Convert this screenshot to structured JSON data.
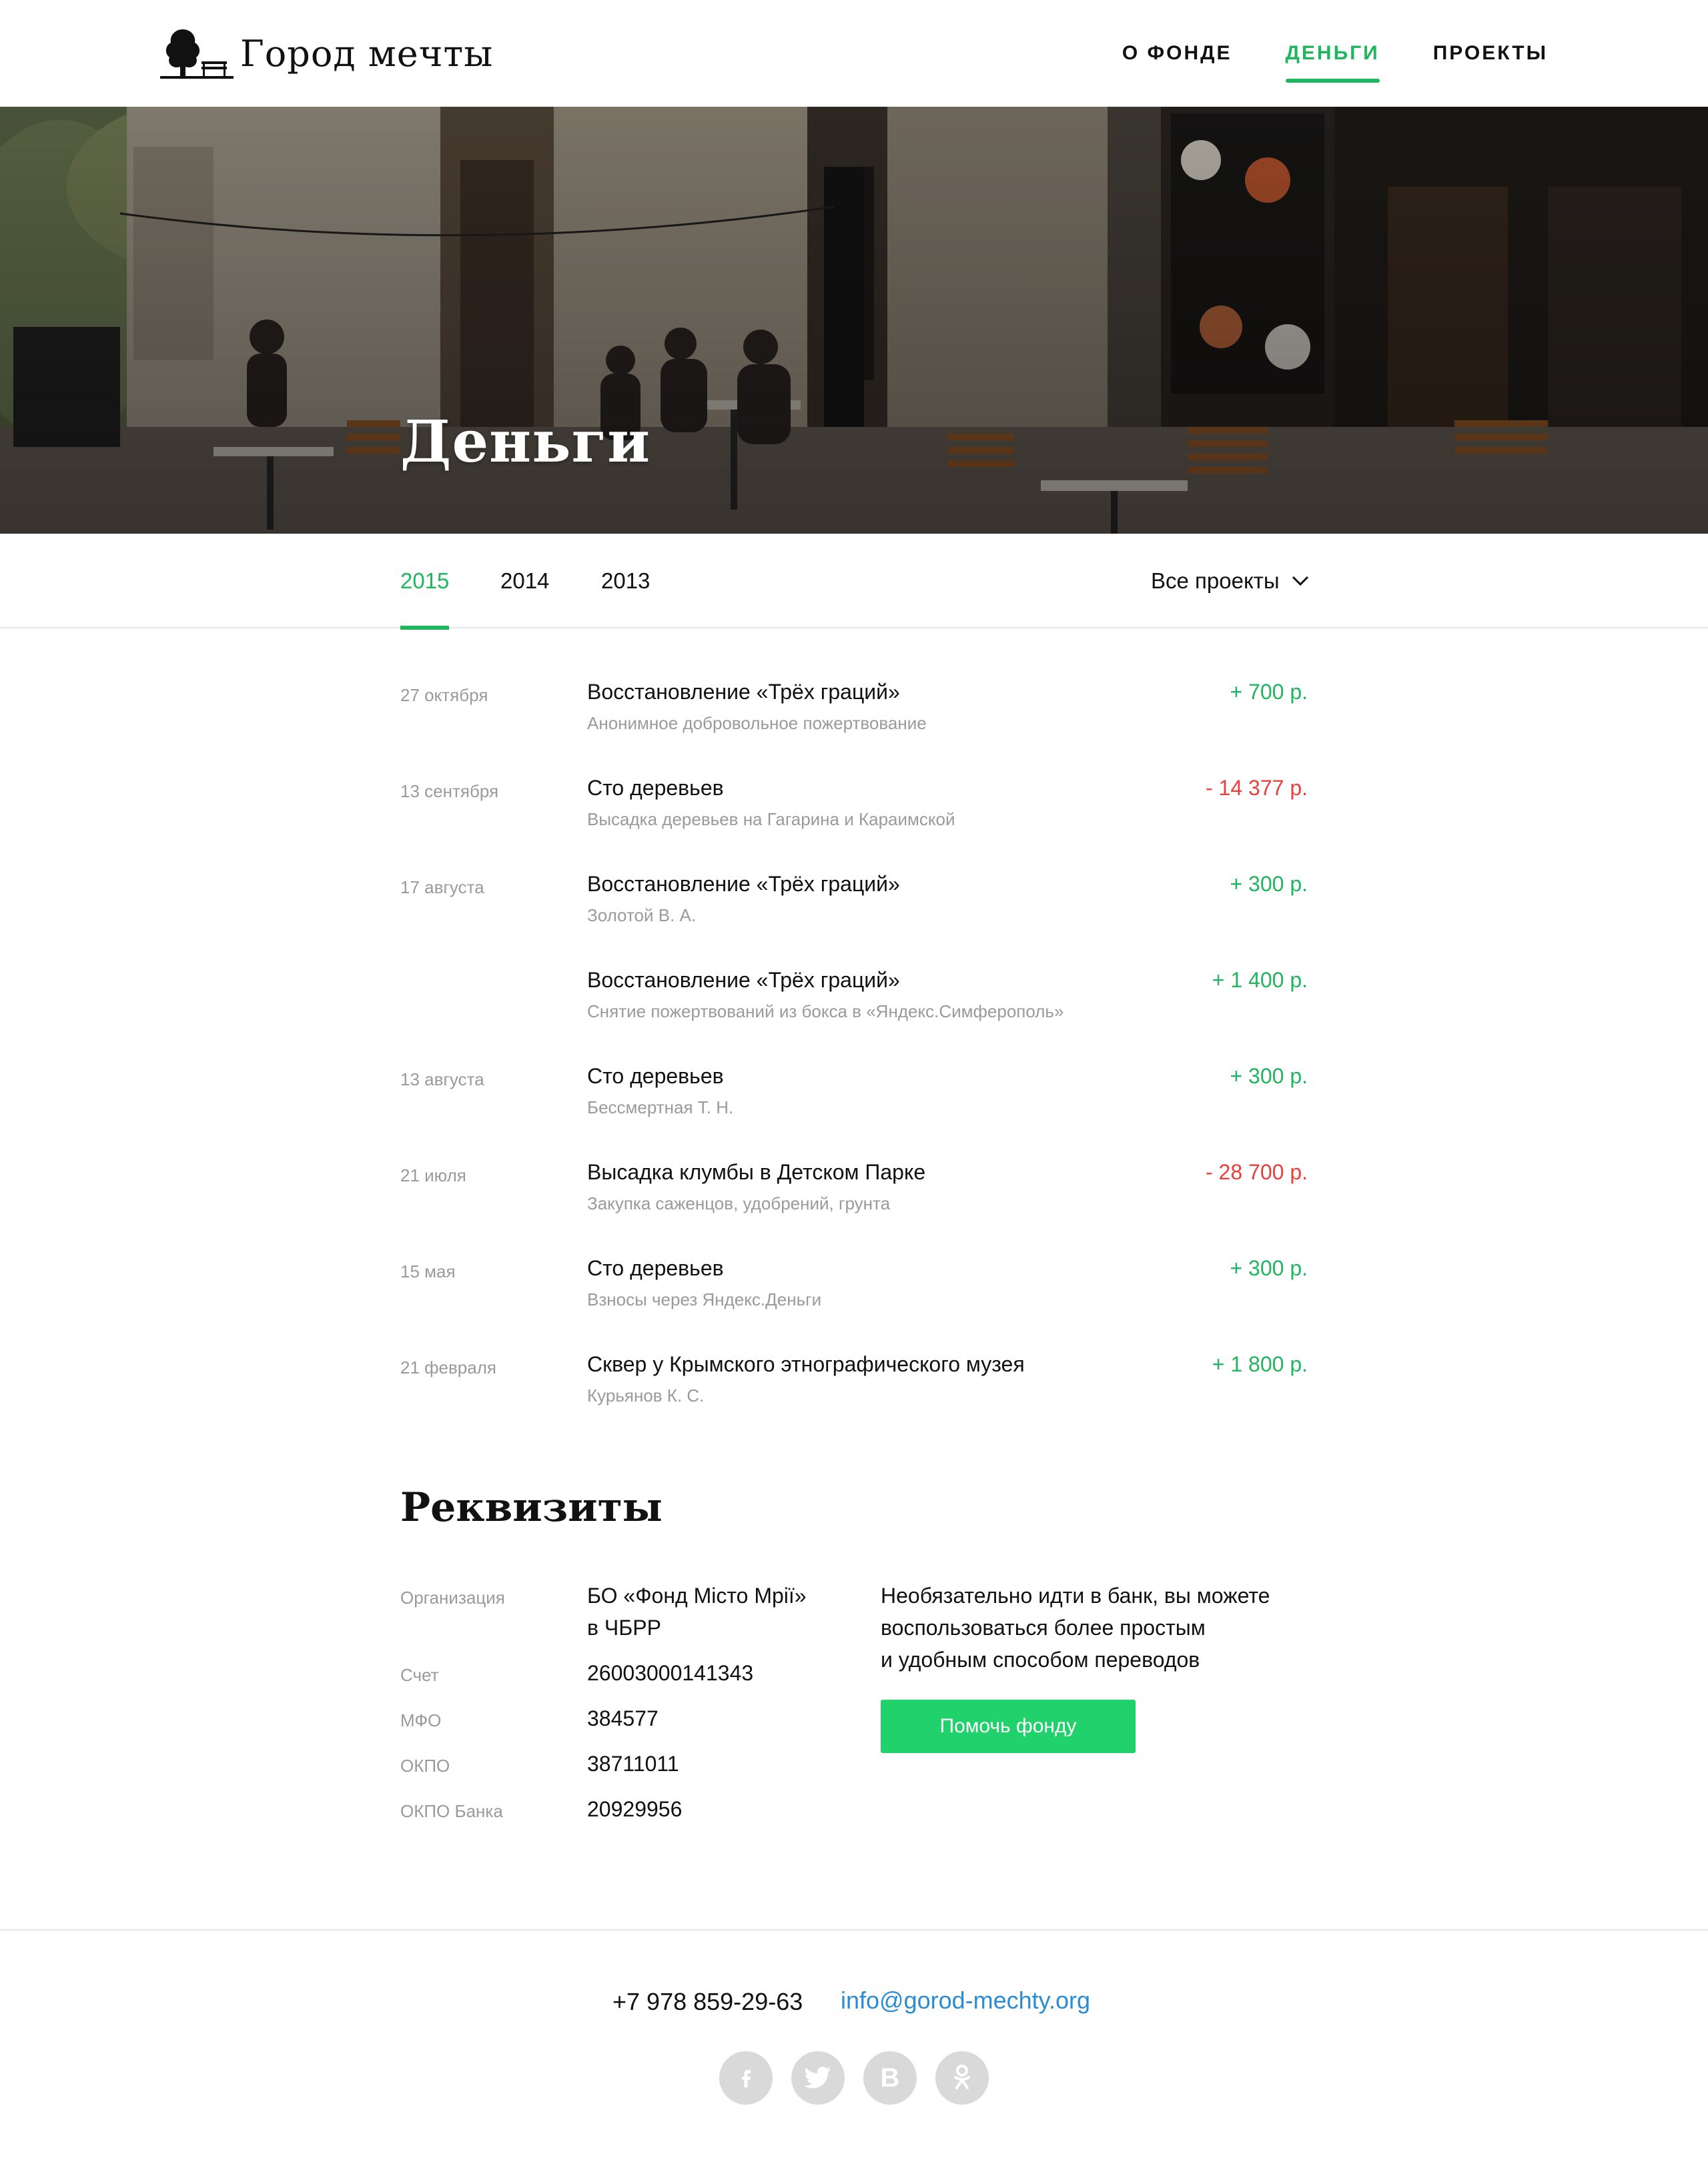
{
  "header": {
    "logo_text": "Город мечты",
    "nav": [
      {
        "label": "О ФОНДЕ"
      },
      {
        "label": "ДЕНЬГИ"
      },
      {
        "label": "ПРОЕКТЫ"
      }
    ],
    "active_nav": "ДЕНЬГИ"
  },
  "hero": {
    "title": "Деньги"
  },
  "tabs": {
    "years": [
      {
        "label": "2015"
      },
      {
        "label": "2014"
      },
      {
        "label": "2013"
      }
    ],
    "active_year": "2015",
    "filter_label": "Все проекты",
    "filter_icon": "chevron-down-icon"
  },
  "transactions": [
    {
      "date": "27 октября",
      "title": "Восстановление «Трёх граций»",
      "subtitle": "Анонимное добровольное пожертвование",
      "amount": "+ 700 р.",
      "type": "income"
    },
    {
      "date": "13 сентября",
      "title": "Сто деревьев",
      "subtitle": "Высадка деревьев на Гагарина и Караимской",
      "amount": "- 14 377 р.",
      "type": "expense"
    },
    {
      "date": "17 августа",
      "title": "Восстановление «Трёх граций»",
      "subtitle": "Золотой В. А.",
      "amount": "+ 300 р.",
      "type": "income"
    },
    {
      "date": "",
      "title": "Восстановление «Трёх граций»",
      "subtitle": "Снятие пожертвований из бокса в «Яндекс.Симферополь»",
      "amount": "+ 1 400 р.",
      "type": "income"
    },
    {
      "date": "13 августа",
      "title": "Сто деревьев",
      "subtitle": "Бессмертная Т. Н.",
      "amount": "+ 300 р.",
      "type": "income"
    },
    {
      "date": "21 июля",
      "title": "Высадка клумбы в Детском Парке",
      "subtitle": "Закупка саженцов, удобрений, грунта",
      "amount": "- 28 700 р.",
      "type": "expense"
    },
    {
      "date": "15 мая",
      "title": "Сто деревьев",
      "subtitle": "Взносы через Яндекс.Деньги",
      "amount": "+ 300 р.",
      "type": "income"
    },
    {
      "date": "21 февраля",
      "title": "Сквер у Крымского этнографического музея",
      "subtitle": "Курьянов К. С.",
      "amount": "+ 1 800 р.",
      "type": "income"
    }
  ],
  "requisites": {
    "title": "Реквизиты",
    "rows": [
      {
        "label": "Организация",
        "value_line1": "БО «Фонд Місто Мрії»",
        "value_line2": "в ЧБРР"
      },
      {
        "label": "Счет",
        "value": "26003000141343"
      },
      {
        "label": "МФО",
        "value": "384577"
      },
      {
        "label": "ОКПО",
        "value": "38711011"
      },
      {
        "label": "ОКПО Банка",
        "value": "20929956"
      }
    ],
    "note_lines": [
      "Необязательно идти в банк, вы можете",
      "воспользоваться более простым",
      "и удобным способом переводов"
    ],
    "help_button": "Помочь фонду"
  },
  "footer": {
    "phone": "+7 978 859-29-63",
    "email": "info@gorod-mechty.org",
    "socials": [
      {
        "icon": "facebook-icon",
        "glyph": "f"
      },
      {
        "icon": "twitter-icon",
        "glyph": ""
      },
      {
        "icon": "vk-icon",
        "glyph": "B"
      },
      {
        "icon": "odnoklassniki-icon",
        "glyph": ""
      }
    ]
  },
  "colors": {
    "accent": "#1fb65d",
    "button": "#21d16b",
    "expense": "#e8413b",
    "link": "#2a8dd4",
    "muted": "#9a9a9a"
  }
}
